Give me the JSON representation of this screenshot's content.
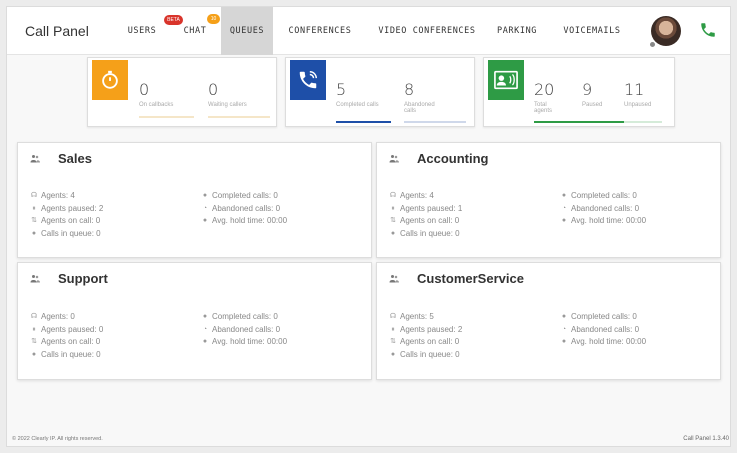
{
  "app": {
    "title": "Call Panel"
  },
  "nav": {
    "users": "USERS",
    "chat": "CHAT",
    "chat_badge": "BETA",
    "chat_count": "10",
    "queues": "QUEUES",
    "conferences": "CONFERENCES",
    "video_conferences": "VIDEO CONFERENCES",
    "parking": "PARKING",
    "voicemails": "VOICEMAILS"
  },
  "stats": {
    "timer_card": {
      "value1": "0",
      "label1": "On callbacks",
      "value2": "0",
      "label2": "Waiting callers",
      "color": "#f5a019"
    },
    "calls_card": {
      "value1": "5",
      "label1": "Completed calls",
      "value2": "8",
      "label2": "Abandoned calls",
      "color": "#1e4fa8"
    },
    "agents_card": {
      "value1": "20",
      "label1": "Total agents",
      "value2": "9",
      "label2": "Paused",
      "value3": "11",
      "label3": "Unpaused",
      "color": "#2e9b45"
    }
  },
  "queues": [
    {
      "name": "Sales",
      "agents": "Agents: 4",
      "paused": "Agents paused: 2",
      "on_call": "Agents on call: 0",
      "in_queue": "Calls in queue: 0",
      "completed": "Completed calls: 0",
      "abandoned": "Abandoned calls: 0",
      "hold": "Avg. hold time: 00:00"
    },
    {
      "name": "Accounting",
      "agents": "Agents: 4",
      "paused": "Agents paused: 1",
      "on_call": "Agents on call: 0",
      "in_queue": "Calls in queue: 0",
      "completed": "Completed calls: 0",
      "abandoned": "Abandoned calls: 0",
      "hold": "Avg. hold time: 00:00"
    },
    {
      "name": "Support",
      "agents": "Agents: 0",
      "paused": "Agents paused: 0",
      "on_call": "Agents on call: 0",
      "in_queue": "Calls in queue: 0",
      "completed": "Completed calls: 0",
      "abandoned": "Abandoned calls: 0",
      "hold": "Avg. hold time: 00:00"
    },
    {
      "name": "CustomerService",
      "agents": "Agents: 5",
      "paused": "Agents paused: 2",
      "on_call": "Agents on call: 0",
      "in_queue": "Calls in queue: 0",
      "completed": "Completed calls: 0",
      "abandoned": "Abandoned calls: 0",
      "hold": "Avg. hold time: 00:00"
    }
  ],
  "footer": {
    "copyright": "© 2022 Clearly IP. All rights reserved.",
    "version": "Call Panel 1.3.40"
  },
  "colors": {
    "phone": "#2e9b45"
  }
}
